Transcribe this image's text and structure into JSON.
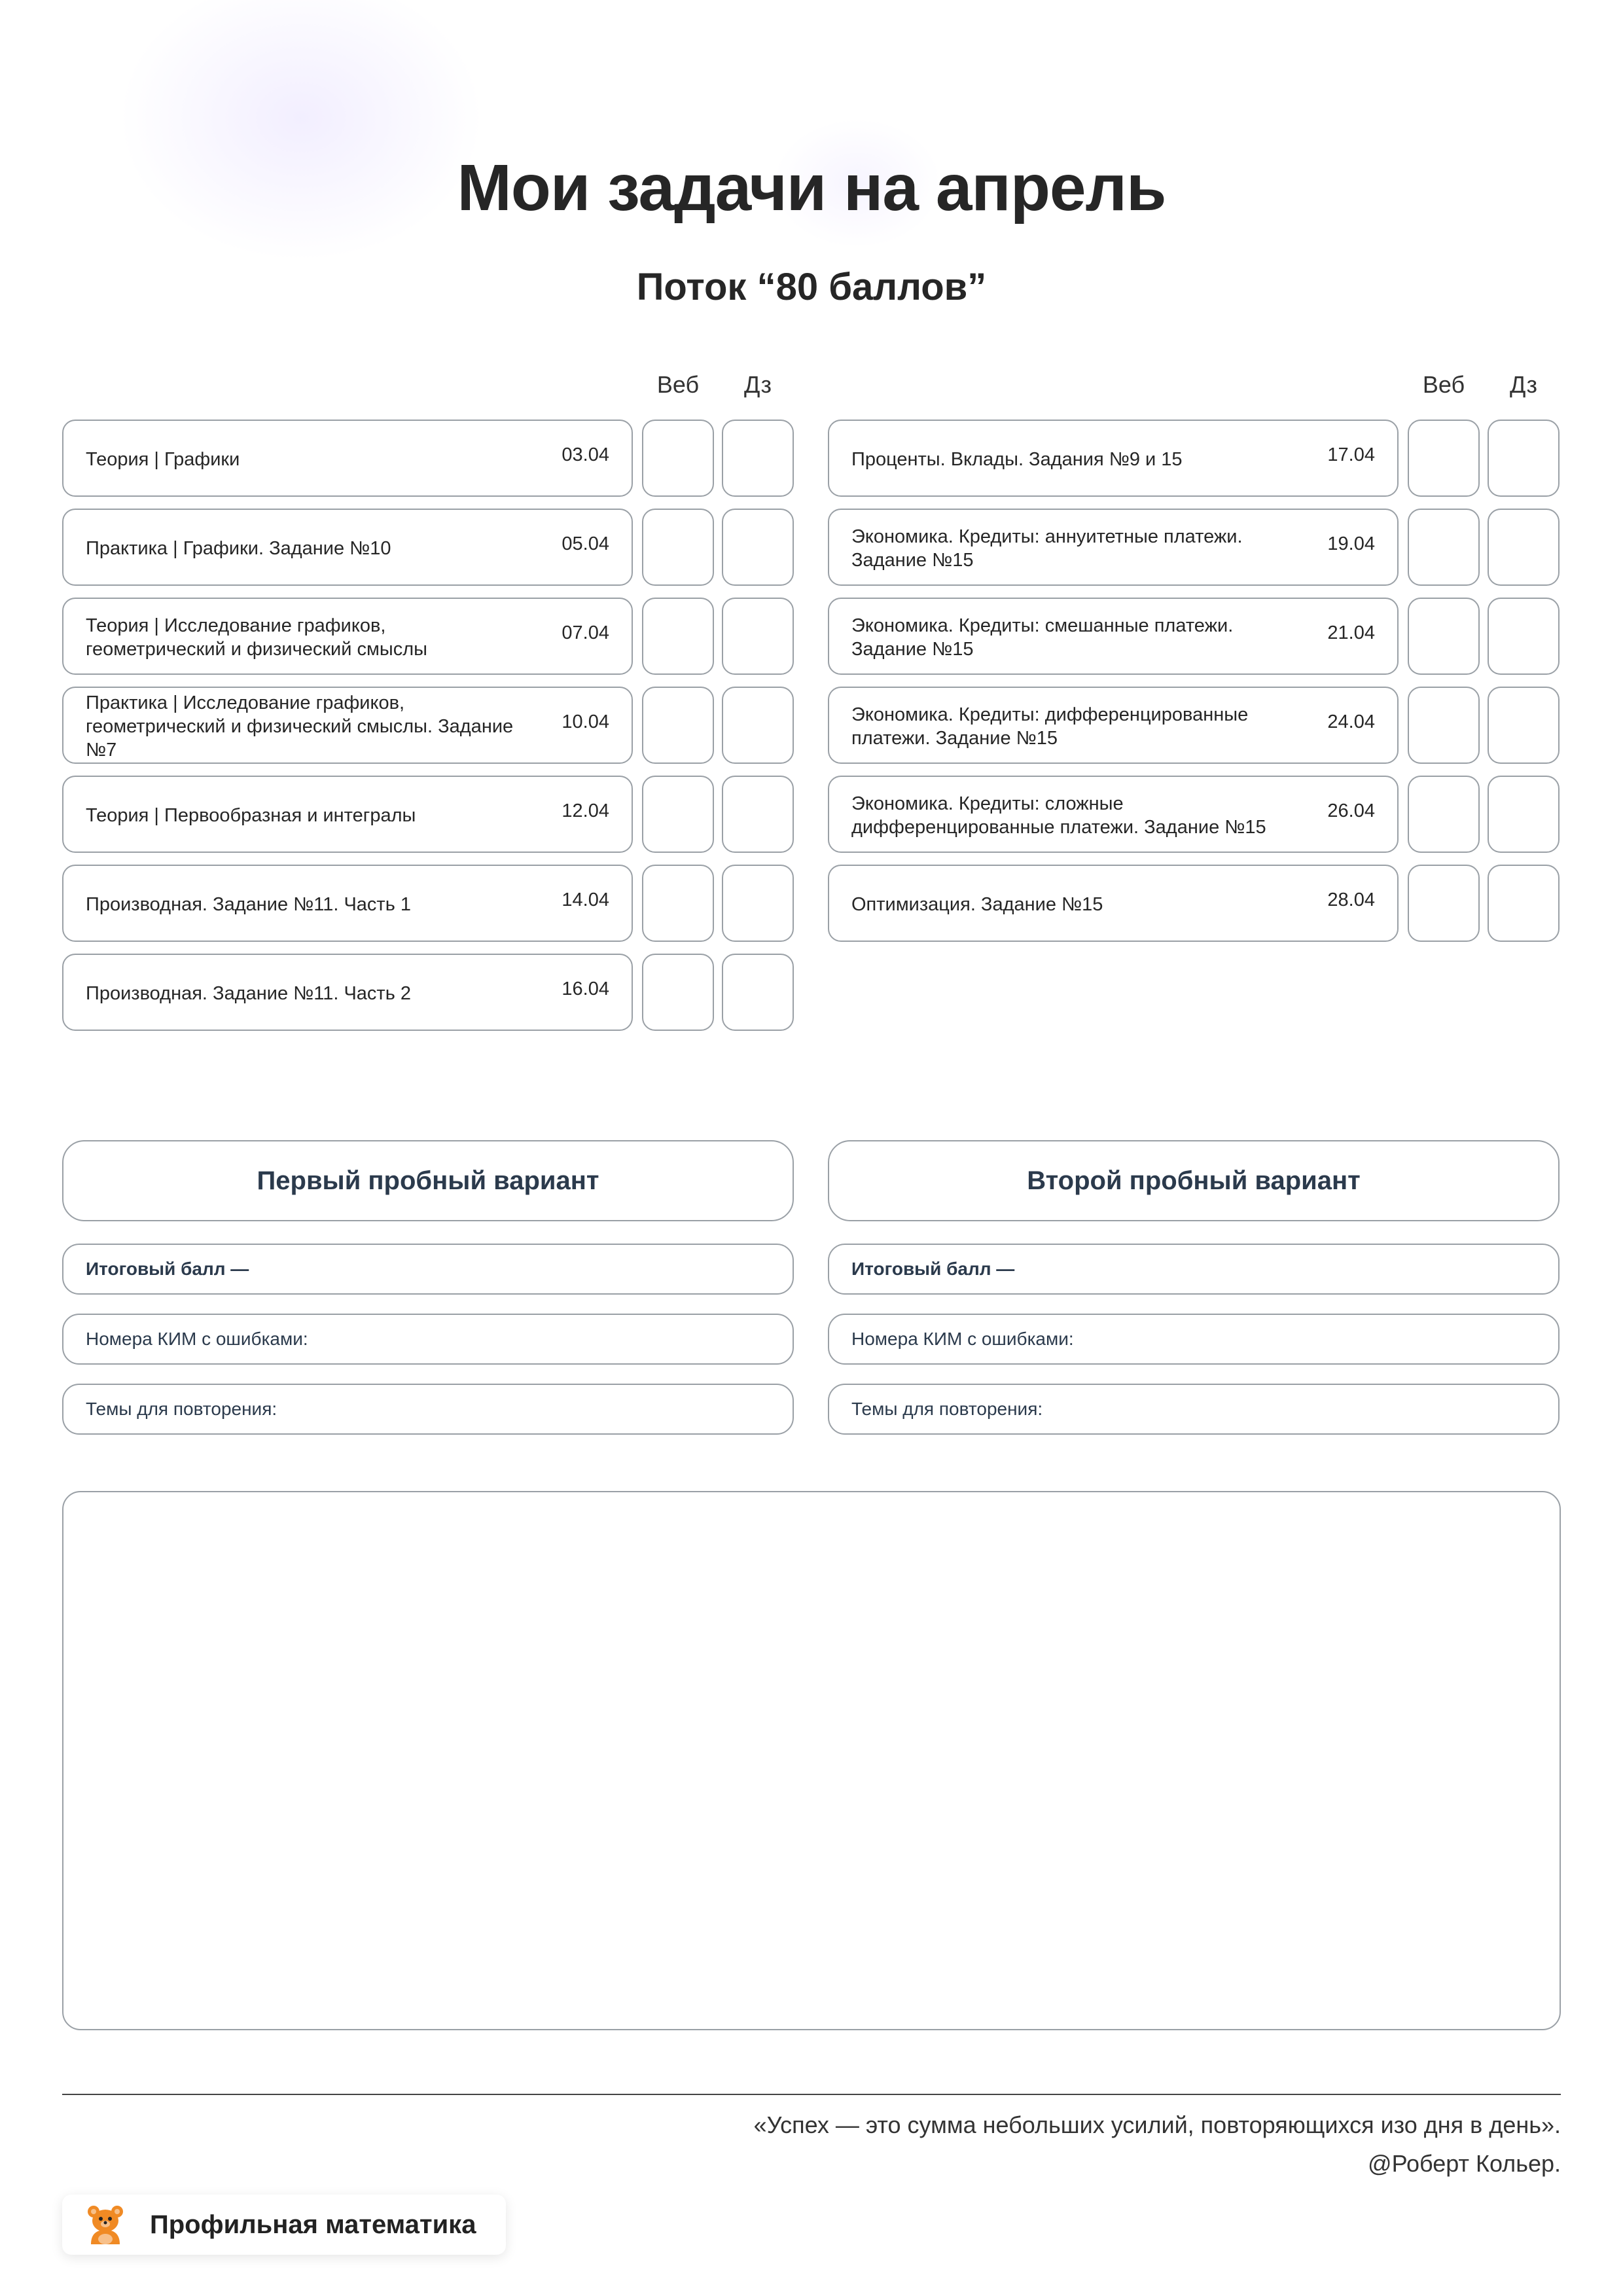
{
  "header": {
    "title": "Мои задачи на апрель",
    "subtitle": "Поток “80 баллов”"
  },
  "columns": {
    "web": "Веб",
    "hw": "Дз"
  },
  "tasks_left": [
    {
      "name": "Теория | Графики",
      "date": "03.04"
    },
    {
      "name": "Практика | Графики. Задание №10",
      "date": "05.04"
    },
    {
      "name": "Теория | Исследование графиков,\nгеометрический и физический смыслы",
      "date": "07.04"
    },
    {
      "name": "Практика | Исследование графиков,\nгеометрический и физический смыслы. Задание №7",
      "date": "10.04"
    },
    {
      "name": "Теория | Первообразная и интегралы",
      "date": "12.04"
    },
    {
      "name": "Производная. Задание №11. Часть 1",
      "date": "14.04"
    },
    {
      "name": "Производная. Задание №11. Часть 2",
      "date": "16.04"
    }
  ],
  "tasks_right": [
    {
      "name": "Проценты. Вклады. Задания №9 и 15",
      "date": "17.04"
    },
    {
      "name": "Экономика. Кредиты: аннуитетные платежи.\nЗадание №15",
      "date": "19.04"
    },
    {
      "name": "Экономика. Кредиты: смешанные платежи.\nЗадание №15",
      "date": "21.04"
    },
    {
      "name": "Экономика. Кредиты: дифференцированные\nплатежи. Задание №15",
      "date": "24.04"
    },
    {
      "name": "Экономика. Кредиты: сложные\nдифференцированные платежи. Задание №15",
      "date": "26.04"
    },
    {
      "name": "Оптимизация. Задание №15",
      "date": "28.04"
    }
  ],
  "variants": [
    {
      "title": "Первый пробный вариант",
      "total": "Итоговый балл —",
      "errors": "Номера КИМ с ошибками:",
      "topics": "Темы для повторения:"
    },
    {
      "title": "Второй пробный вариант",
      "total": "Итоговый балл —",
      "errors": "Номера КИМ с ошибками:",
      "topics": "Темы для повторения:"
    }
  ],
  "footer": {
    "quote": "«Успех — это сумма небольших усилий, повторяющихся изо дня в день».",
    "author": "@Роберт Кольер.",
    "brand": "Профильная математика",
    "logo_icon": "bear-mascot-icon"
  },
  "colors": {
    "border": "#9aa0a6",
    "text": "#262626",
    "accent_text": "#2b3a4c",
    "logo_orange": "#f08a24"
  }
}
